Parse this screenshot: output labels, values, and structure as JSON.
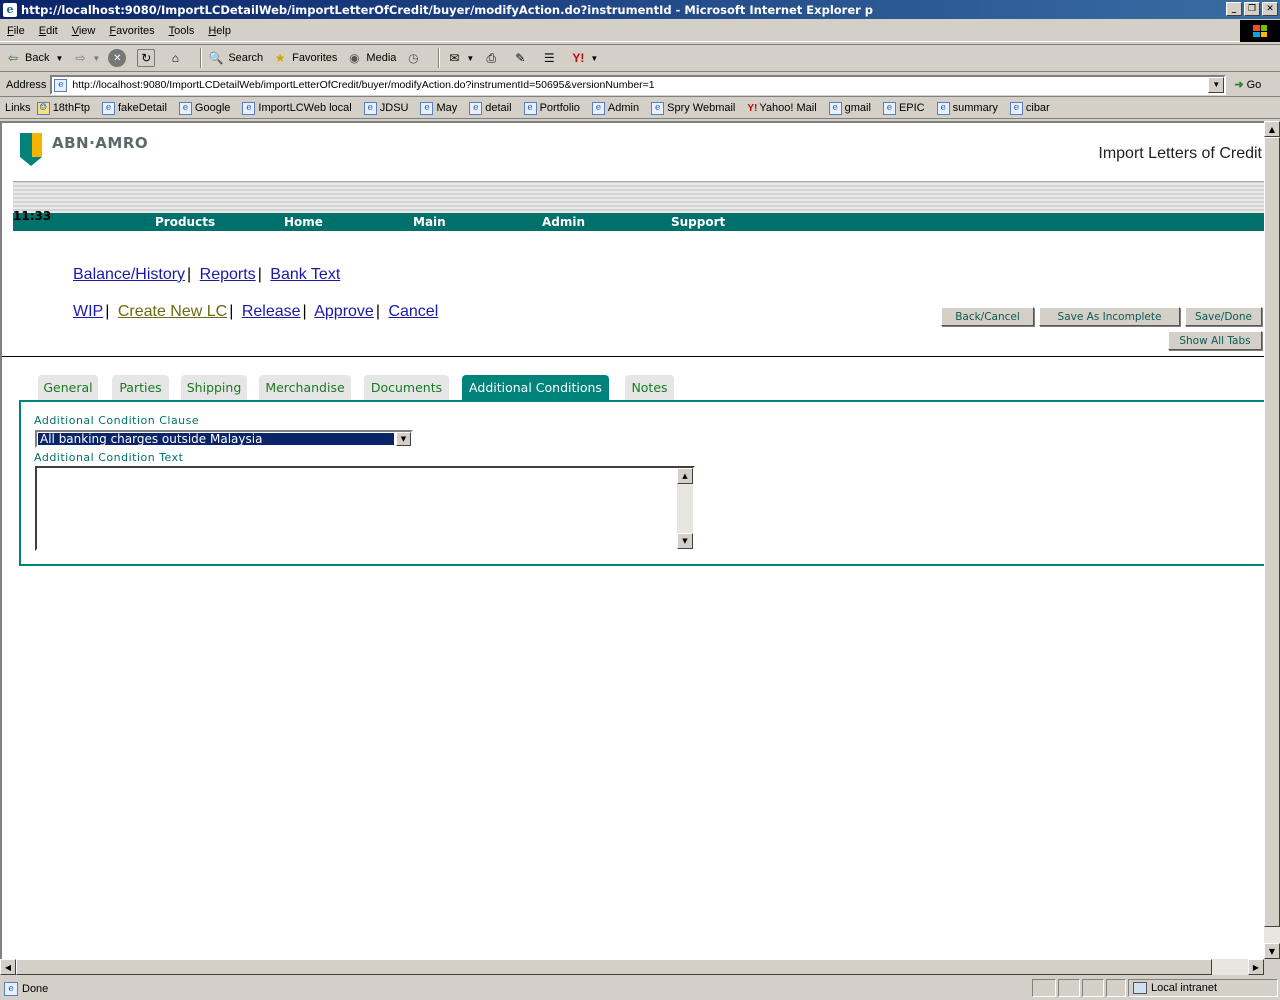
{
  "window": {
    "title": "http://localhost:9080/ImportLCDetailWeb/importLetterOfCredit/buyer/modifyAction.do?instrumentId - Microsoft Internet Explorer p"
  },
  "menu": [
    "File",
    "Edit",
    "View",
    "Favorites",
    "Tools",
    "Help"
  ],
  "toolbar": {
    "back": "Back",
    "search": "Search",
    "favorites": "Favorites",
    "media": "Media"
  },
  "address": {
    "label": "Address",
    "url": "http://localhost:9080/ImportLCDetailWeb/importLetterOfCredit/buyer/modifyAction.do?instrumentId=50695&versionNumber=1",
    "go": "Go"
  },
  "links": {
    "label": "Links",
    "items": [
      "18thFtp",
      "fakeDetail",
      "Google",
      "ImportLCWeb local",
      "JDSU",
      "May",
      "detail",
      "Portfolio",
      "Admin",
      "Spry Webmail",
      "Yahoo! Mail",
      "gmail",
      "EPIC",
      "summary",
      "cibar"
    ]
  },
  "page": {
    "brand": "ABN·AMRO",
    "module_title": "Import Letters of Credit",
    "time": "11:33",
    "nav": [
      "Products",
      "Home",
      "Main",
      "Admin",
      "Support"
    ],
    "links_row1": [
      "Balance/History",
      "Reports",
      "Bank Text"
    ],
    "links_row2": [
      "WIP",
      "Create New LC",
      "Release",
      "Approve",
      "Cancel"
    ],
    "buttons": {
      "back_cancel": "Back/Cancel",
      "save_incomplete": "Save As Incomplete",
      "save_done": "Save/Done",
      "show_all_tabs": "Show All Tabs"
    },
    "tabs": [
      "General",
      "Parties",
      "Shipping",
      "Merchandise",
      "Documents",
      "Additional Conditions",
      "Notes"
    ],
    "active_tab": "Additional Conditions",
    "form": {
      "clause_label": "Additional Condition Clause",
      "clause_value": "All banking charges outside Malaysia",
      "text_label": "Additional Condition Text",
      "text_value": ""
    }
  },
  "status": {
    "text": "Done",
    "zone": "Local intranet"
  },
  "colors": {
    "brand_teal": "#00837b",
    "nav_teal": "#00706b",
    "link_blue": "#1a1aa6",
    "title_bar": "#0a246a"
  }
}
